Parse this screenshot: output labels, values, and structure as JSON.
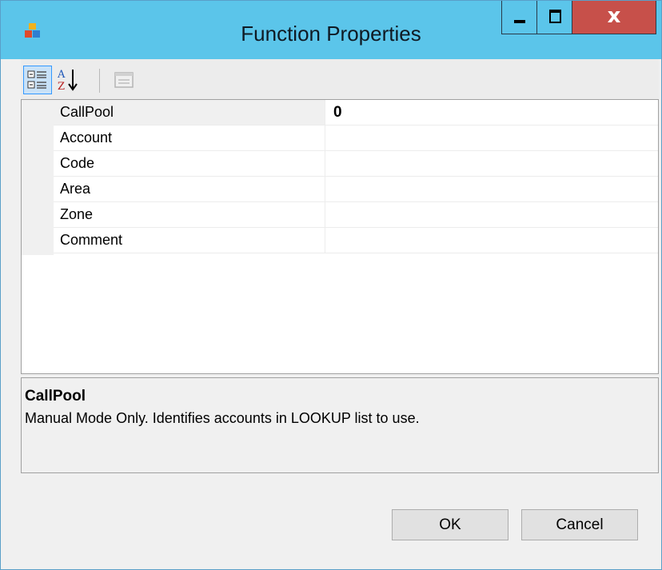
{
  "window": {
    "title": "Function Properties",
    "close_glyph": "x"
  },
  "icons": {
    "app": "app-icon",
    "minimize": "minimize-icon",
    "maximize": "maximize-icon",
    "close": "close-icon",
    "categorized": "categorized-icon",
    "alphabetical": "alphabetical-sort-icon",
    "property_pages": "property-pages-icon"
  },
  "properties": [
    {
      "name": "CallPool",
      "value": "0"
    },
    {
      "name": "Account",
      "value": ""
    },
    {
      "name": "Code",
      "value": ""
    },
    {
      "name": "Area",
      "value": ""
    },
    {
      "name": "Zone",
      "value": ""
    },
    {
      "name": "Comment",
      "value": ""
    }
  ],
  "description": {
    "title": "CallPool",
    "text": "Manual Mode Only. Identifies accounts in LOOKUP list to use."
  },
  "buttons": {
    "ok": "OK",
    "cancel": "Cancel"
  },
  "colors": {
    "titlebar": "#5bc5ea",
    "close_button": "#c7504a",
    "selected_tool": "#c9e2f8"
  }
}
